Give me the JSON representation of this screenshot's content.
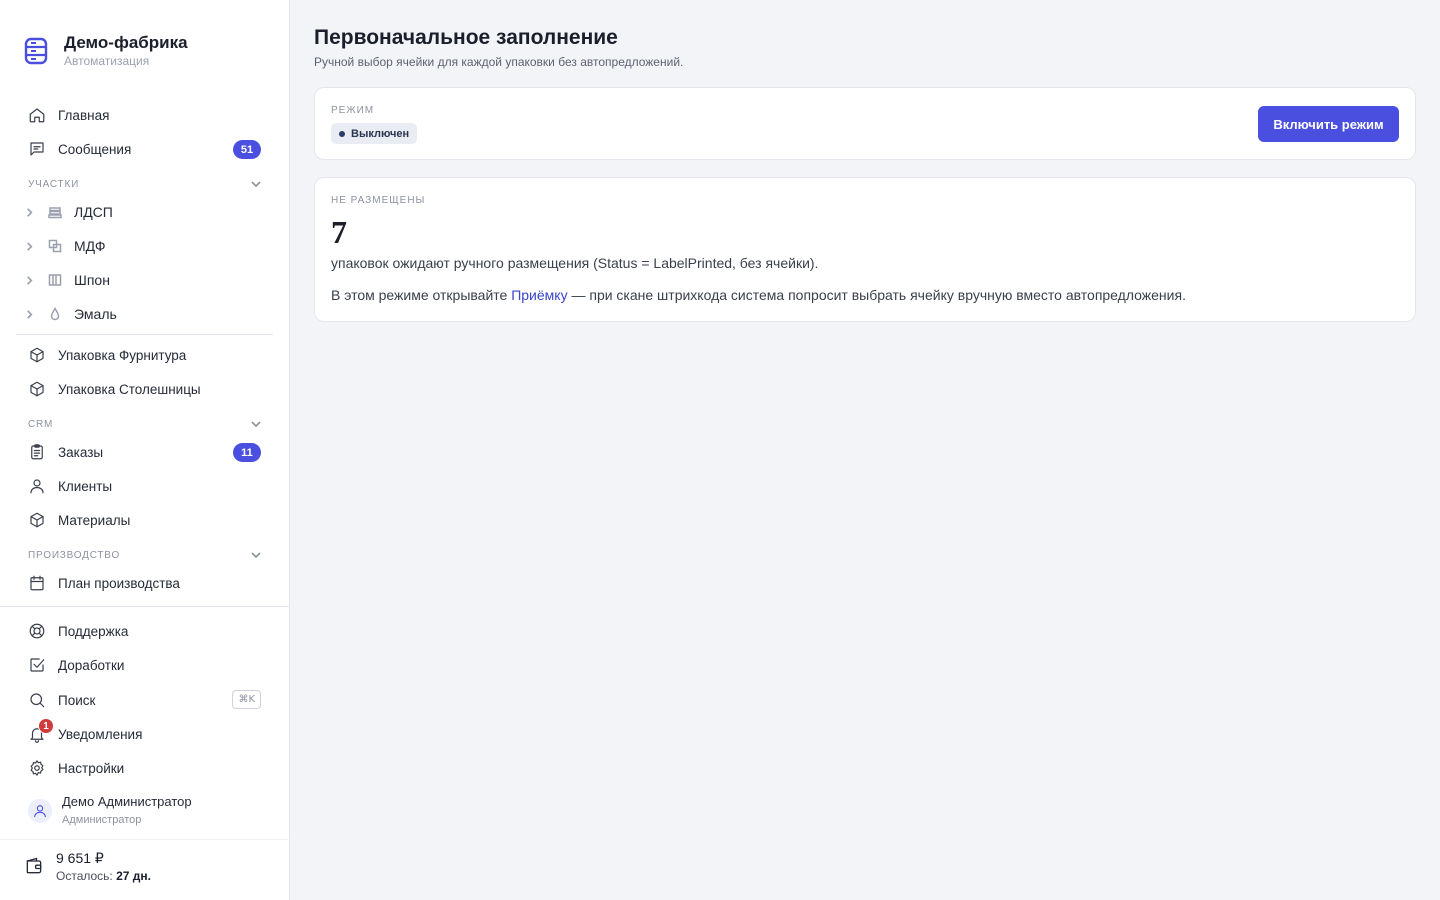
{
  "brand": {
    "name": "Демо-фабрика",
    "subtitle": "Автоматизация"
  },
  "nav": {
    "home": "Главная",
    "messages": {
      "label": "Сообщения",
      "badge": "51"
    }
  },
  "sections": {
    "areas": "Участки",
    "crm": "CRM",
    "production": "Производство"
  },
  "areas": [
    {
      "label": "ЛДСП",
      "icon": "layers-icon"
    },
    {
      "label": "МДФ",
      "icon": "copy-icon"
    },
    {
      "label": "Шпон",
      "icon": "columns-icon"
    },
    {
      "label": "Эмаль",
      "icon": "droplet-icon"
    }
  ],
  "packaging": {
    "hardware": "Упаковка Фурнитура",
    "countertops": "Упаковка Столешницы"
  },
  "crm": {
    "orders": {
      "label": "Заказы",
      "badge": "11"
    },
    "clients": "Клиенты",
    "materials": "Материалы"
  },
  "production": {
    "plan": "План производства"
  },
  "bottom": {
    "support": "Поддержка",
    "improvements": "Доработки",
    "search": {
      "label": "Поиск",
      "shortcut": "⌘K"
    },
    "notifications": {
      "label": "Уведомления",
      "count": "1"
    },
    "settings": "Настройки"
  },
  "user": {
    "name": "Демо Администратор",
    "role": "Администратор"
  },
  "wallet": {
    "amount": "9 651 ₽",
    "left_label": "Осталось:",
    "left_value": "27 дн."
  },
  "page": {
    "title": "Первоначальное заполнение",
    "subtitle": "Ручной выбор ячейки для каждой упаковки без автопредложений."
  },
  "mode_card": {
    "label": "Режим",
    "status": "Выключен",
    "button": "Включить режим"
  },
  "stats_card": {
    "label": "Не размещены",
    "count": "7",
    "description": "упаковок ожидают ручного размещения (Status = LabelPrinted, без ячейки).",
    "hint_before": "В этом режиме открывайте ",
    "hint_link": "Приёмку",
    "hint_after": " — при скане штрихкода система попросит выбрать ячейку вручную вместо автопредложения."
  },
  "colors": {
    "accent": "#4b4fe0",
    "danger": "#cf3a3a",
    "background": "#f3f4f8"
  }
}
